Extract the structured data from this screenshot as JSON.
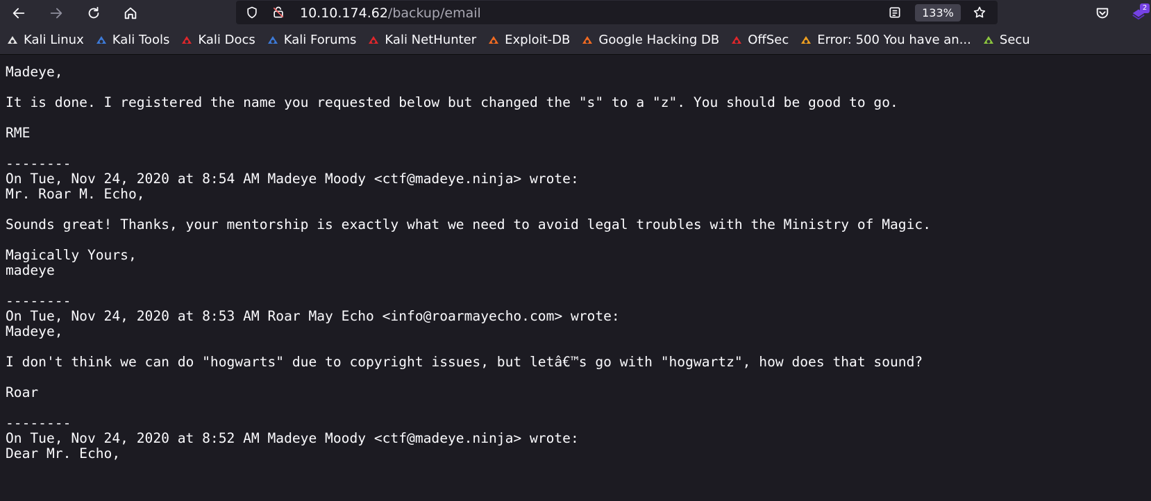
{
  "browser": {
    "url_host": "10.10.174.62",
    "url_path": "/backup/email",
    "zoom": "133%",
    "extension_badge": "2"
  },
  "bookmarks": [
    {
      "label": "Kali Linux",
      "icon": "kali-dragon-icon",
      "color": "#e6e6e6"
    },
    {
      "label": "Kali Tools",
      "icon": "kali-tools-icon",
      "color": "#3d7bd9"
    },
    {
      "label": "Kali Docs",
      "icon": "kali-docs-icon",
      "color": "#e0262b"
    },
    {
      "label": "Kali Forums",
      "icon": "kali-forums-icon",
      "color": "#3d7bd9"
    },
    {
      "label": "Kali NetHunter",
      "icon": "nethunter-icon",
      "color": "#e0262b"
    },
    {
      "label": "Exploit-DB",
      "icon": "exploit-db-icon",
      "color": "#f26b21"
    },
    {
      "label": "Google Hacking DB",
      "icon": "ghdb-icon",
      "color": "#f26b21"
    },
    {
      "label": "OffSec",
      "icon": "offsec-icon",
      "color": "#e0262b"
    },
    {
      "label": "Error: 500 You have an...",
      "icon": "joomla-icon",
      "color": "#f0a020"
    },
    {
      "label": "Secu",
      "icon": "security-icon",
      "color": "#8cc63f"
    }
  ],
  "email_lines": [
    "Madeye,",
    "",
    "It is done. I registered the name you requested below but changed the \"s\" to a \"z\". You should be good to go.",
    "",
    "RME",
    "",
    "--------",
    "On Tue, Nov 24, 2020 at 8:54 AM Madeye Moody <ctf@madeye.ninja> wrote:",
    "Mr. Roar M. Echo,",
    "",
    "Sounds great! Thanks, your mentorship is exactly what we need to avoid legal troubles with the Ministry of Magic.",
    "",
    "Magically Yours,",
    "madeye",
    "",
    "--------",
    "On Tue, Nov 24, 2020 at 8:53 AM Roar May Echo <info@roarmayecho.com> wrote:",
    "Madeye,",
    "",
    "I don't think we can do \"hogwarts\" due to copyright issues, but letâ€™s go with \"hogwartz\", how does that sound?",
    "",
    "Roar",
    "",
    "--------",
    "On Tue, Nov 24, 2020 at 8:52 AM Madeye Moody <ctf@madeye.ninja> wrote:",
    "Dear Mr. Echo,"
  ]
}
